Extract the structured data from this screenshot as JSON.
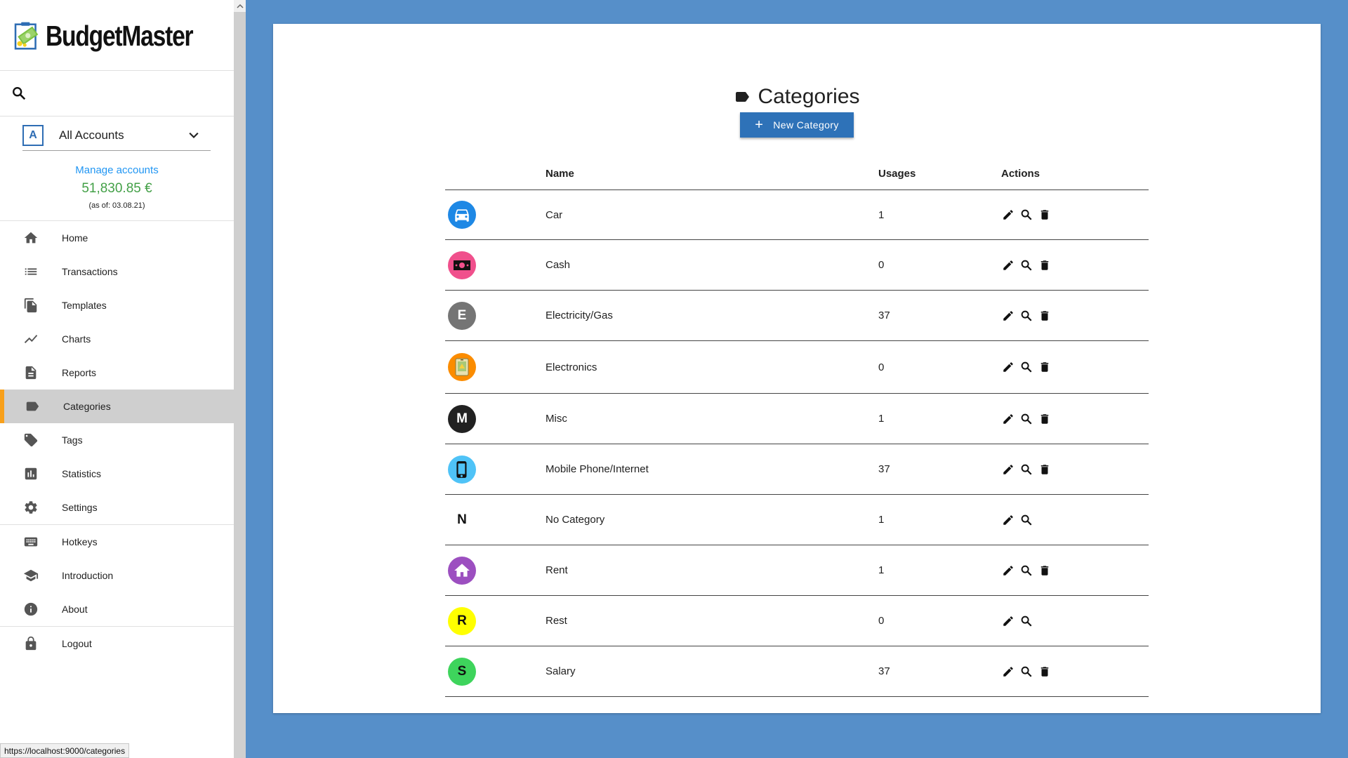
{
  "app": {
    "name": "BudgetMaster"
  },
  "status_url": "https://localhost:9000/categories",
  "sidebar": {
    "account_select": {
      "letter": "A",
      "label": "All Accounts"
    },
    "manage_accounts": "Manage accounts",
    "balance": "51,830.85 €",
    "balance_asof": "(as of: 03.08.21)",
    "nav": [
      {
        "label": "Home",
        "icon": "home-icon"
      },
      {
        "label": "Transactions",
        "icon": "list-icon"
      },
      {
        "label": "Templates",
        "icon": "file-copy-icon"
      },
      {
        "label": "Charts",
        "icon": "line-chart-icon"
      },
      {
        "label": "Reports",
        "icon": "report-icon"
      },
      {
        "label": "Categories",
        "icon": "label-icon",
        "active": true
      },
      {
        "label": "Tags",
        "icon": "tag-icon"
      },
      {
        "label": "Statistics",
        "icon": "bar-chart-icon"
      },
      {
        "label": "Settings",
        "icon": "gear-icon"
      },
      {
        "label": "Hotkeys",
        "icon": "keyboard-icon"
      },
      {
        "label": "Introduction",
        "icon": "school-icon"
      },
      {
        "label": "About",
        "icon": "info-icon"
      },
      {
        "label": "Logout",
        "icon": "lock-icon"
      }
    ]
  },
  "main": {
    "title": "Categories",
    "new_button": "New Category",
    "table": {
      "headers": {
        "name": "Name",
        "usages": "Usages",
        "actions": "Actions"
      },
      "rows": [
        {
          "name": "Car",
          "usages": "1",
          "color": "#1e88e5",
          "icon": "car-icon",
          "letter": "",
          "deletable": true
        },
        {
          "name": "Cash",
          "usages": "0",
          "color": "#f0508c",
          "icon": "money-icon",
          "letter": "",
          "deletable": true
        },
        {
          "name": "Electricity/Gas",
          "usages": "37",
          "color": "#757575",
          "icon": "",
          "letter": "E",
          "deletable": true
        },
        {
          "name": "Electronics",
          "usages": "0",
          "color": "#fb8c00",
          "icon": "electronics-image-icon",
          "letter": "",
          "deletable": true
        },
        {
          "name": "Misc",
          "usages": "1",
          "color": "#212121",
          "icon": "",
          "letter": "M",
          "deletable": true
        },
        {
          "name": "Mobile Phone/Internet",
          "usages": "37",
          "color": "#4fc3f7",
          "icon": "phone-icon",
          "letter": "",
          "deletable": true
        },
        {
          "name": "No Category",
          "usages": "1",
          "color": "#ffffff",
          "icon": "",
          "letter": "N",
          "deletable": false
        },
        {
          "name": "Rent",
          "usages": "1",
          "color": "#9c4fc0",
          "icon": "house-icon",
          "letter": "",
          "deletable": true
        },
        {
          "name": "Rest",
          "usages": "0",
          "color": "#ffff00",
          "icon": "",
          "letter": "R",
          "deletable": false
        },
        {
          "name": "Salary",
          "usages": "37",
          "color": "#3ed45c",
          "icon": "",
          "letter": "S",
          "deletable": true
        }
      ]
    }
  }
}
